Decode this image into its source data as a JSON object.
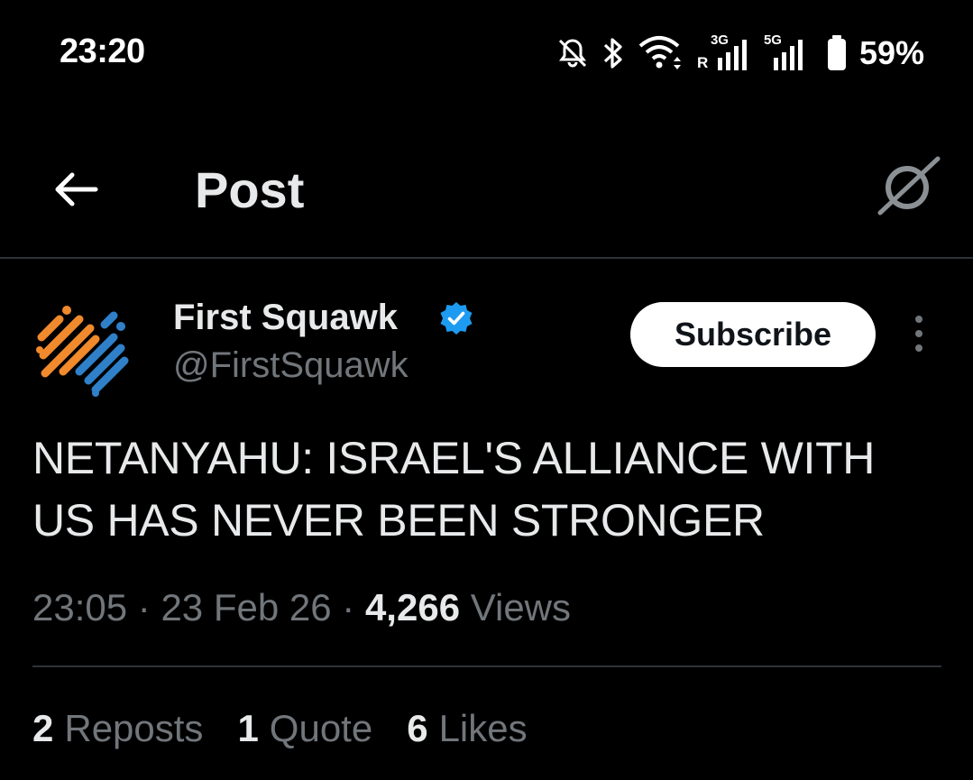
{
  "status_bar": {
    "time": "23:20",
    "net1_label": "3G",
    "net1_roaming": "R",
    "net2_label": "5G",
    "battery": "59%",
    "icons": [
      "mute-icon",
      "bluetooth-icon",
      "wifi-icon",
      "signal-icon",
      "signal-icon",
      "battery-icon"
    ]
  },
  "header": {
    "title": "Post"
  },
  "post": {
    "author": {
      "name": "First Squawk",
      "handle": "@FirstSquawk",
      "verified": true
    },
    "subscribe_label": "Subscribe",
    "text": "NETANYAHU: ISRAEL'S ALLIANCE WITH US HAS NEVER BEEN STRONGER",
    "time": "23:05",
    "date": "23 Feb 26",
    "views_count": "4,266",
    "views_label": "Views",
    "separator": "·"
  },
  "stats": {
    "reposts_count": "2",
    "reposts_label": "Reposts",
    "quotes_count": "1",
    "quotes_label": "Quote",
    "likes_count": "6",
    "likes_label": "Likes"
  },
  "colors": {
    "background": "#000000",
    "text_primary": "#e7e9ea",
    "text_secondary": "#71767b",
    "verified": "#1d9bf0",
    "logo_orange": "#f08a2c",
    "logo_blue": "#2f80c9"
  }
}
